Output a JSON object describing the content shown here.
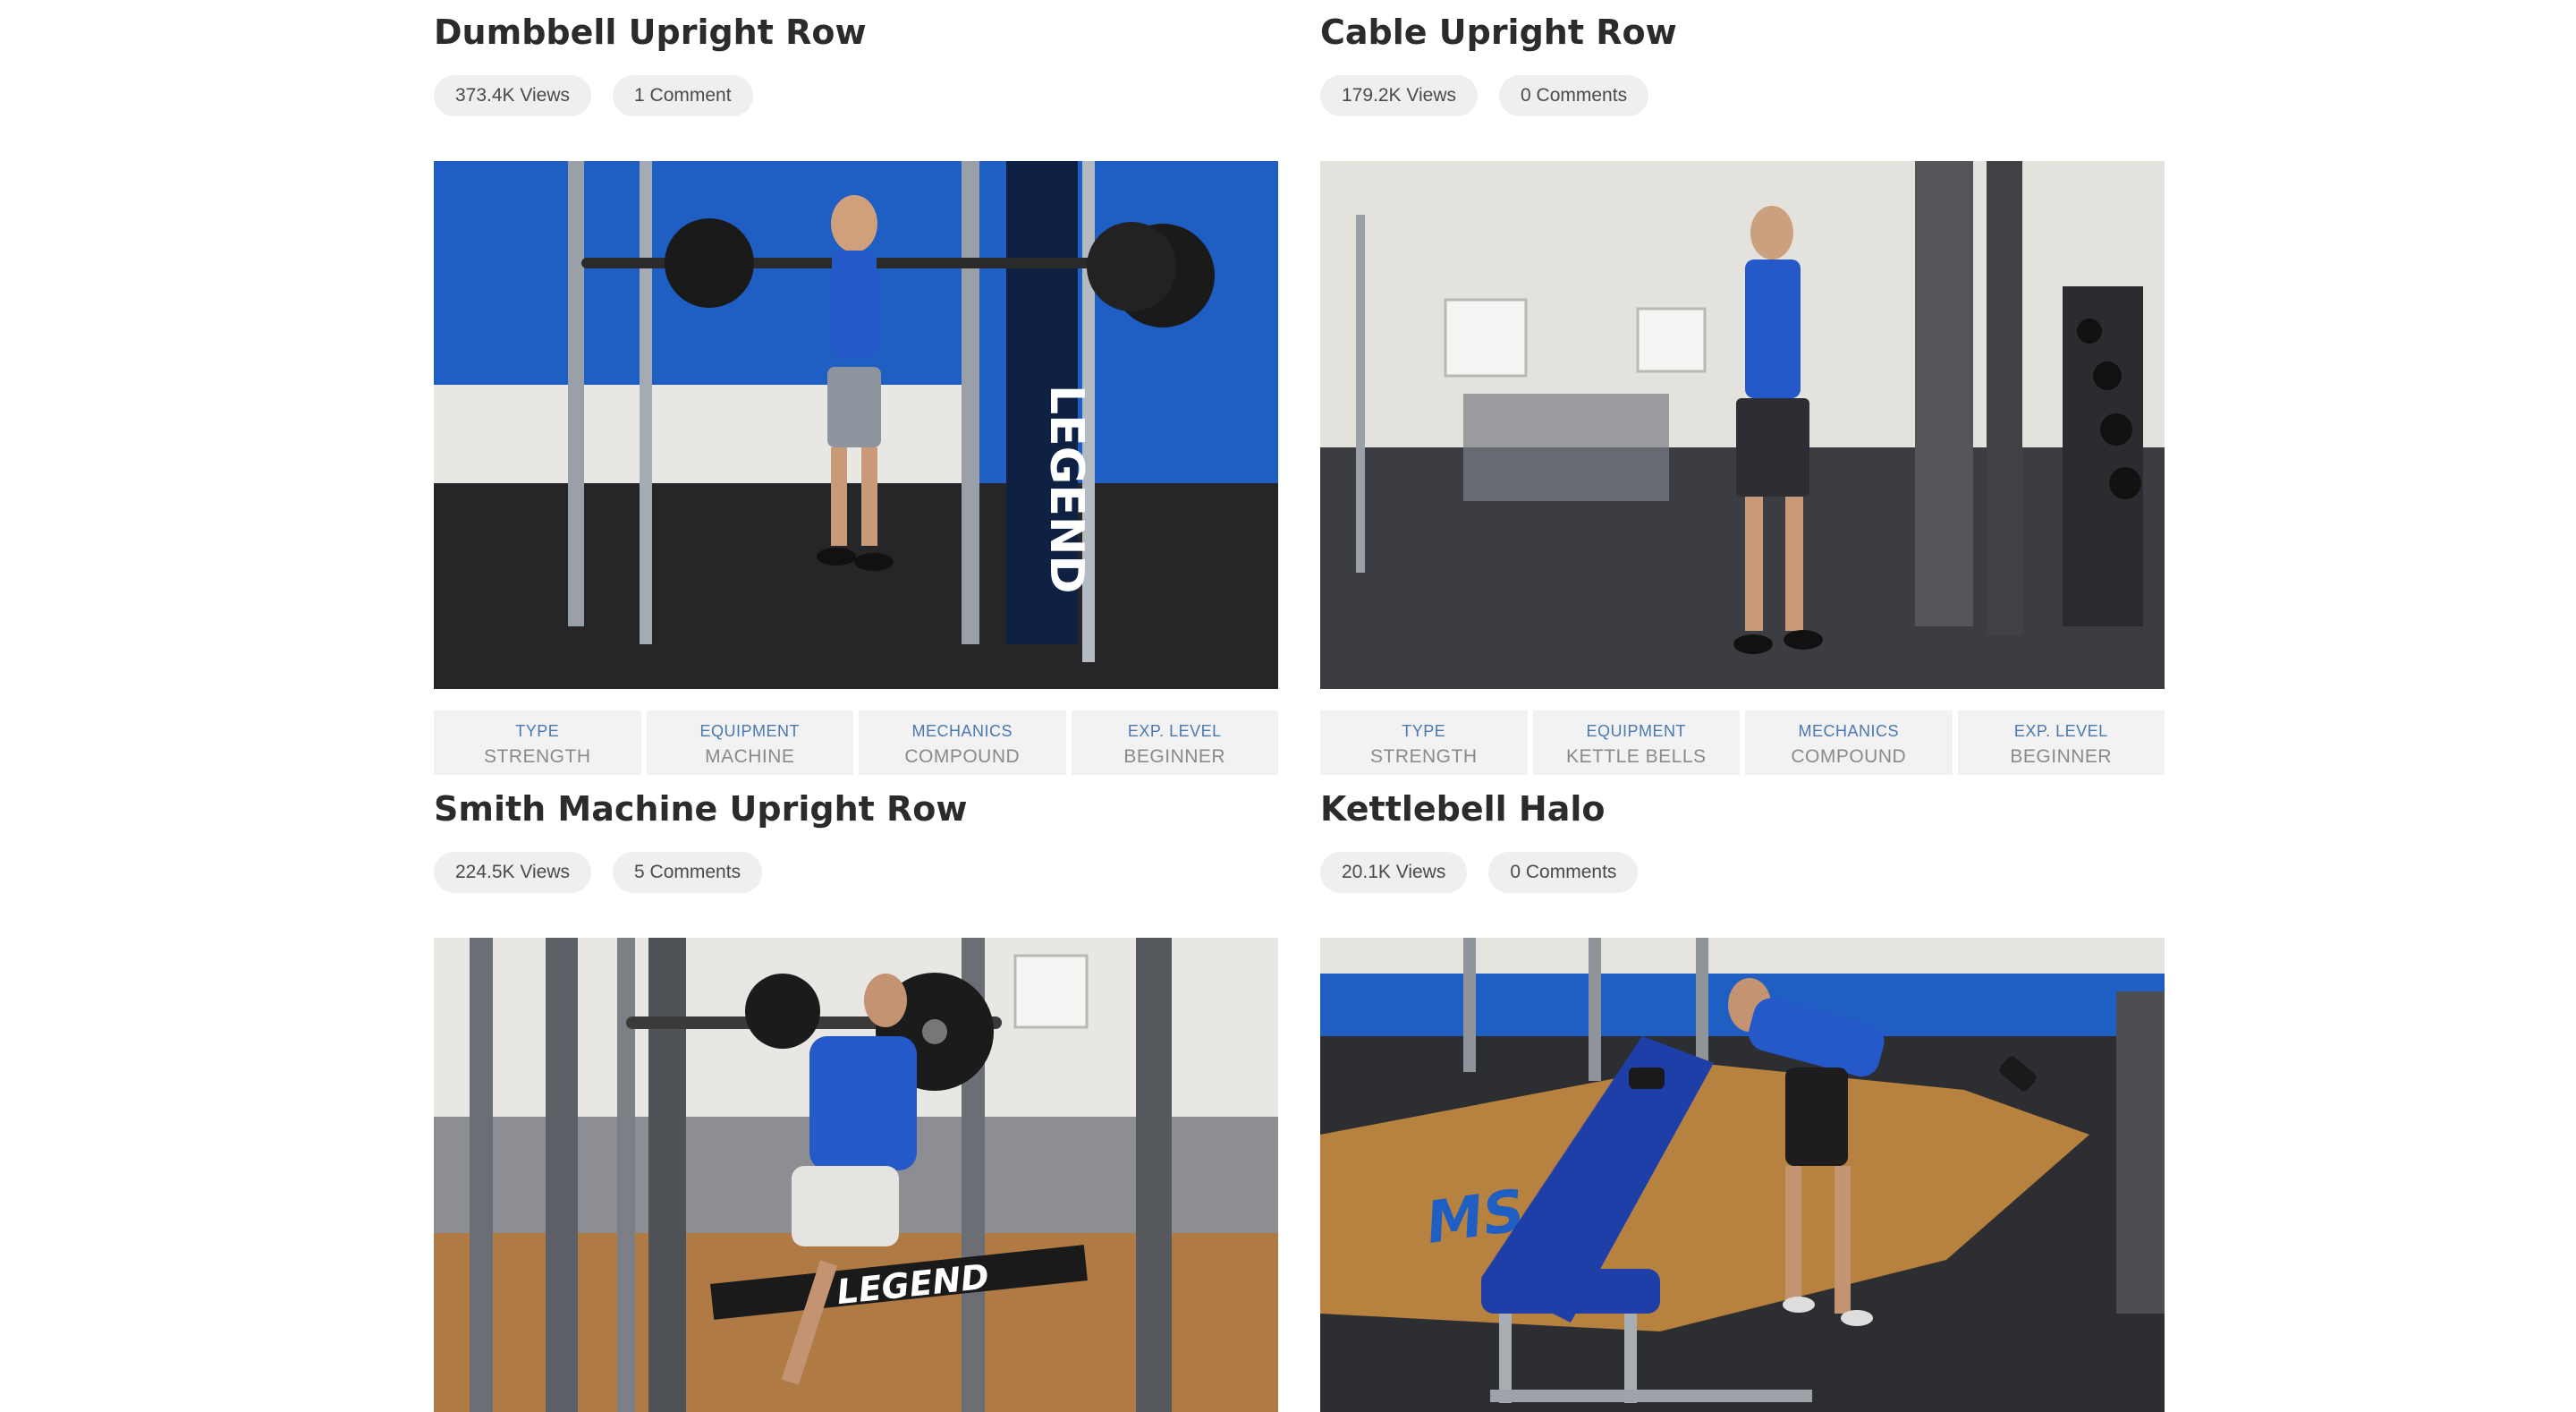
{
  "exercises": [
    {
      "title": "Dumbbell Upright Row",
      "views": "373.4K Views",
      "comments": "1 Comment",
      "tags": [
        {
          "label": "TYPE",
          "value": "STRENGTH"
        },
        {
          "label": "EQUIPMENT",
          "value": "MACHINE"
        },
        {
          "label": "MECHANICS",
          "value": "COMPOUND"
        },
        {
          "label": "EXP. LEVEL",
          "value": "BEGINNER"
        }
      ],
      "image_logo": "LEGEND"
    },
    {
      "title": "Cable Upright Row",
      "views": "179.2K Views",
      "comments": "0 Comments",
      "tags": [
        {
          "label": "TYPE",
          "value": "STRENGTH"
        },
        {
          "label": "EQUIPMENT",
          "value": "KETTLE BELLS"
        },
        {
          "label": "MECHANICS",
          "value": "COMPOUND"
        },
        {
          "label": "EXP. LEVEL",
          "value": "BEGINNER"
        }
      ]
    },
    {
      "title": "Smith Machine Upright Row",
      "views": "224.5K Views",
      "comments": "5 Comments",
      "image_logo": "LEGEND"
    },
    {
      "title": "Kettlebell Halo",
      "views": "20.1K Views",
      "comments": "0 Comments",
      "image_logo": "MS"
    }
  ],
  "colors": {
    "tag_label": "#4a78b2",
    "tag_value": "#8a8a8a",
    "pill_bg": "#efefef",
    "tag_bg": "#f2f2f2",
    "title": "#2b2b2b"
  }
}
